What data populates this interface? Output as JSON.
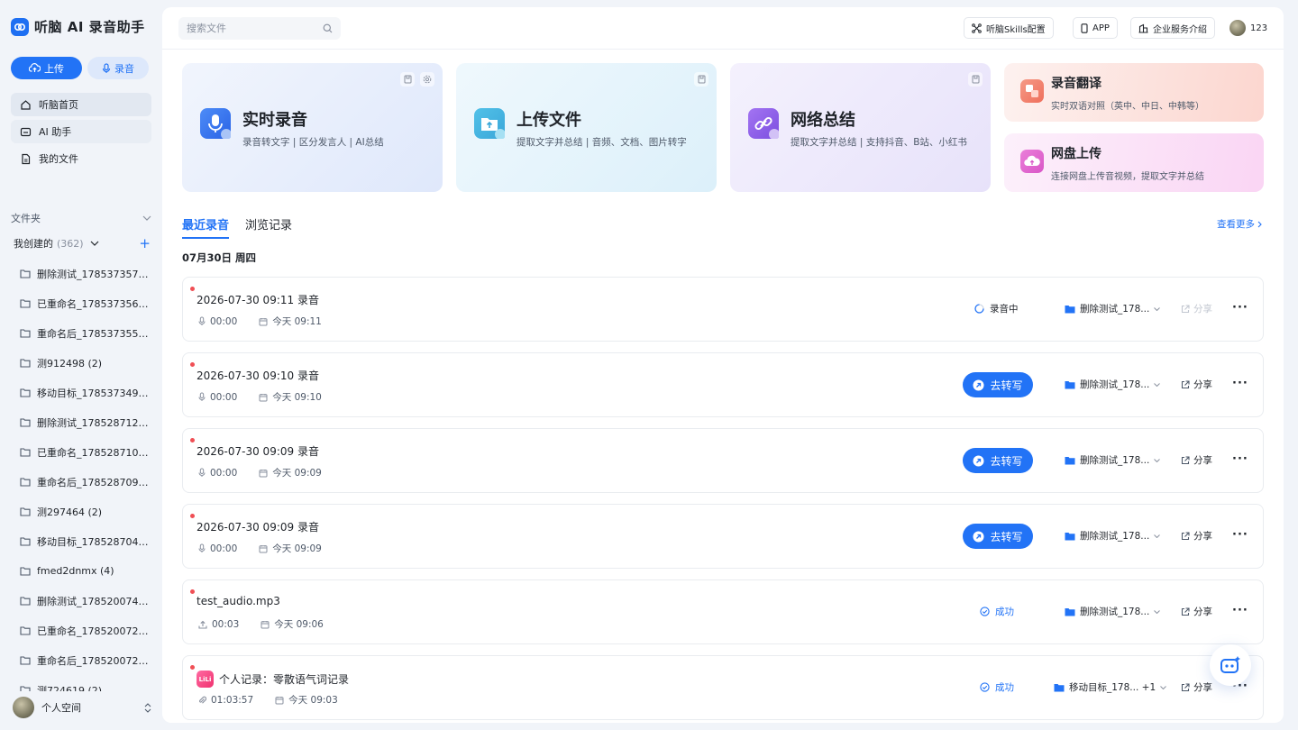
{
  "brand": {
    "name": "听脑 AI 录音助手",
    "icon": "brand-logo-icon"
  },
  "actions": {
    "upload": "上传",
    "record": "录音"
  },
  "nav": [
    {
      "label": "听脑首页",
      "icon": "home-icon"
    },
    {
      "label": "AI 助手",
      "icon": "ai-icon"
    },
    {
      "label": "我的文件",
      "icon": "file-icon"
    }
  ],
  "folders": {
    "title": "文件夹",
    "created_label": "我创建的",
    "created_count": "(362)",
    "items": [
      "删除测试_1785373577 ...",
      "已重命名_1785373562 ...",
      "重命名后_1785373552 ...",
      "测912498 (2)",
      "移动目标_1785373497 ...",
      "删除测试_1785287120 ...",
      "已重命名_1785287107 (...",
      "重命名后_1785287096 ...",
      "测297464 (2)",
      "移动目标_1785287046 ...",
      "fmed2dnmx (4)",
      "删除测试_1785200743 ...",
      "已重命名_1785200729 ...",
      "重命名后_1785200720 ...",
      "测724619 (2)"
    ]
  },
  "user": {
    "space": "个人空间",
    "name": "123"
  },
  "topbar": {
    "search_placeholder": "搜索文件",
    "skills": "听脑Skills配置",
    "app": "APP",
    "enterprise": "企业服务介绍"
  },
  "cards": [
    {
      "title": "实时录音",
      "subtitle": "录音转文字 | 区分发言人 | AI总结"
    },
    {
      "title": "上传文件",
      "subtitle": "提取文字并总结 | 音频、文档、图片转字"
    },
    {
      "title": "网络总结",
      "subtitle": "提取文字并总结 | 支持抖音、B站、小红书"
    }
  ],
  "side_cards": [
    {
      "title": "录音翻译",
      "subtitle": "实时双语对照（英中、中日、中韩等）"
    },
    {
      "title": "网盘上传",
      "subtitle": "连接网盘上传音视频，提取文字并总结"
    }
  ],
  "tabs": {
    "recent": "最近录音",
    "history": "浏览记录",
    "more": "查看更多"
  },
  "date_group": "07月30日 周四",
  "records": [
    {
      "title": "2026-07-30 09:11 录音",
      "duration": "00:00",
      "time": "今天 09:11",
      "status": "录音中",
      "folder": "删除测试_178...",
      "share": "分享"
    },
    {
      "title": "2026-07-30 09:10 录音",
      "duration": "00:00",
      "time": "今天 09:10",
      "action": "去转写",
      "folder": "删除测试_178...",
      "share": "分享"
    },
    {
      "title": "2026-07-30 09:09 录音",
      "duration": "00:00",
      "time": "今天 09:09",
      "action": "去转写",
      "folder": "删除测试_178...",
      "share": "分享"
    },
    {
      "title": "2026-07-30 09:09 录音",
      "duration": "00:00",
      "time": "今天 09:09",
      "action": "去转写",
      "folder": "删除测试_178...",
      "share": "分享"
    },
    {
      "title": "test_audio.mp3",
      "duration": "00:03",
      "time": "今天 09:06",
      "status": "成功",
      "folder": "删除测试_178...",
      "share": "分享"
    },
    {
      "title": "个人记录：零散语气词记录",
      "duration": "01:03:57",
      "time": "今天 09:03",
      "status": "成功",
      "folder": "移动目标_178... +1",
      "share": "分享",
      "badge": "LiLi"
    }
  ],
  "colors": {
    "accent": "#2273f6",
    "record_dot": "#f04f55",
    "bg": "#f1f4f9"
  }
}
